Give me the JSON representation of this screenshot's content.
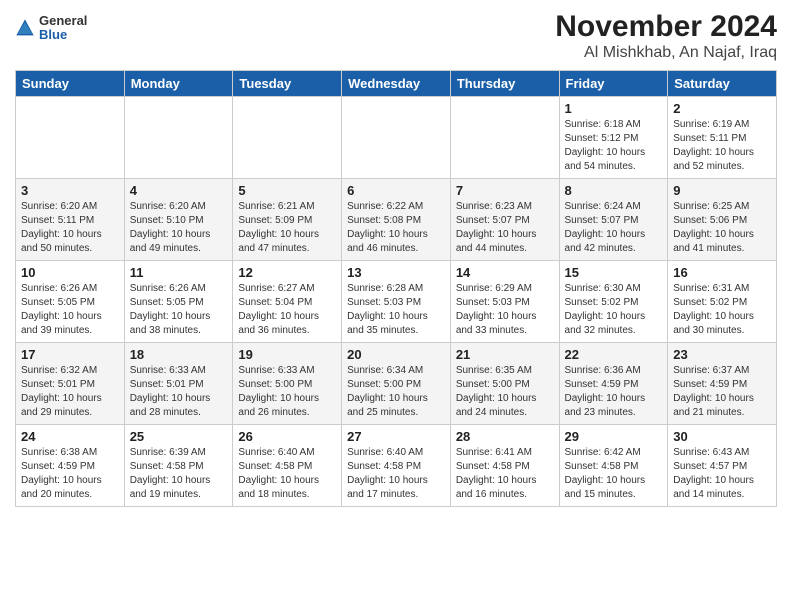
{
  "header": {
    "title": "November 2024",
    "subtitle": "Al Mishkhab, An Najaf, Iraq"
  },
  "logo": {
    "line1": "General",
    "line2": "Blue"
  },
  "days_of_week": [
    "Sunday",
    "Monday",
    "Tuesday",
    "Wednesday",
    "Thursday",
    "Friday",
    "Saturday"
  ],
  "weeks": [
    [
      {
        "day": "",
        "info": ""
      },
      {
        "day": "",
        "info": ""
      },
      {
        "day": "",
        "info": ""
      },
      {
        "day": "",
        "info": ""
      },
      {
        "day": "",
        "info": ""
      },
      {
        "day": "1",
        "info": "Sunrise: 6:18 AM\nSunset: 5:12 PM\nDaylight: 10 hours\nand 54 minutes."
      },
      {
        "day": "2",
        "info": "Sunrise: 6:19 AM\nSunset: 5:11 PM\nDaylight: 10 hours\nand 52 minutes."
      }
    ],
    [
      {
        "day": "3",
        "info": "Sunrise: 6:20 AM\nSunset: 5:11 PM\nDaylight: 10 hours\nand 50 minutes."
      },
      {
        "day": "4",
        "info": "Sunrise: 6:20 AM\nSunset: 5:10 PM\nDaylight: 10 hours\nand 49 minutes."
      },
      {
        "day": "5",
        "info": "Sunrise: 6:21 AM\nSunset: 5:09 PM\nDaylight: 10 hours\nand 47 minutes."
      },
      {
        "day": "6",
        "info": "Sunrise: 6:22 AM\nSunset: 5:08 PM\nDaylight: 10 hours\nand 46 minutes."
      },
      {
        "day": "7",
        "info": "Sunrise: 6:23 AM\nSunset: 5:07 PM\nDaylight: 10 hours\nand 44 minutes."
      },
      {
        "day": "8",
        "info": "Sunrise: 6:24 AM\nSunset: 5:07 PM\nDaylight: 10 hours\nand 42 minutes."
      },
      {
        "day": "9",
        "info": "Sunrise: 6:25 AM\nSunset: 5:06 PM\nDaylight: 10 hours\nand 41 minutes."
      }
    ],
    [
      {
        "day": "10",
        "info": "Sunrise: 6:26 AM\nSunset: 5:05 PM\nDaylight: 10 hours\nand 39 minutes."
      },
      {
        "day": "11",
        "info": "Sunrise: 6:26 AM\nSunset: 5:05 PM\nDaylight: 10 hours\nand 38 minutes."
      },
      {
        "day": "12",
        "info": "Sunrise: 6:27 AM\nSunset: 5:04 PM\nDaylight: 10 hours\nand 36 minutes."
      },
      {
        "day": "13",
        "info": "Sunrise: 6:28 AM\nSunset: 5:03 PM\nDaylight: 10 hours\nand 35 minutes."
      },
      {
        "day": "14",
        "info": "Sunrise: 6:29 AM\nSunset: 5:03 PM\nDaylight: 10 hours\nand 33 minutes."
      },
      {
        "day": "15",
        "info": "Sunrise: 6:30 AM\nSunset: 5:02 PM\nDaylight: 10 hours\nand 32 minutes."
      },
      {
        "day": "16",
        "info": "Sunrise: 6:31 AM\nSunset: 5:02 PM\nDaylight: 10 hours\nand 30 minutes."
      }
    ],
    [
      {
        "day": "17",
        "info": "Sunrise: 6:32 AM\nSunset: 5:01 PM\nDaylight: 10 hours\nand 29 minutes."
      },
      {
        "day": "18",
        "info": "Sunrise: 6:33 AM\nSunset: 5:01 PM\nDaylight: 10 hours\nand 28 minutes."
      },
      {
        "day": "19",
        "info": "Sunrise: 6:33 AM\nSunset: 5:00 PM\nDaylight: 10 hours\nand 26 minutes."
      },
      {
        "day": "20",
        "info": "Sunrise: 6:34 AM\nSunset: 5:00 PM\nDaylight: 10 hours\nand 25 minutes."
      },
      {
        "day": "21",
        "info": "Sunrise: 6:35 AM\nSunset: 5:00 PM\nDaylight: 10 hours\nand 24 minutes."
      },
      {
        "day": "22",
        "info": "Sunrise: 6:36 AM\nSunset: 4:59 PM\nDaylight: 10 hours\nand 23 minutes."
      },
      {
        "day": "23",
        "info": "Sunrise: 6:37 AM\nSunset: 4:59 PM\nDaylight: 10 hours\nand 21 minutes."
      }
    ],
    [
      {
        "day": "24",
        "info": "Sunrise: 6:38 AM\nSunset: 4:59 PM\nDaylight: 10 hours\nand 20 minutes."
      },
      {
        "day": "25",
        "info": "Sunrise: 6:39 AM\nSunset: 4:58 PM\nDaylight: 10 hours\nand 19 minutes."
      },
      {
        "day": "26",
        "info": "Sunrise: 6:40 AM\nSunset: 4:58 PM\nDaylight: 10 hours\nand 18 minutes."
      },
      {
        "day": "27",
        "info": "Sunrise: 6:40 AM\nSunset: 4:58 PM\nDaylight: 10 hours\nand 17 minutes."
      },
      {
        "day": "28",
        "info": "Sunrise: 6:41 AM\nSunset: 4:58 PM\nDaylight: 10 hours\nand 16 minutes."
      },
      {
        "day": "29",
        "info": "Sunrise: 6:42 AM\nSunset: 4:58 PM\nDaylight: 10 hours\nand 15 minutes."
      },
      {
        "day": "30",
        "info": "Sunrise: 6:43 AM\nSunset: 4:57 PM\nDaylight: 10 hours\nand 14 minutes."
      }
    ]
  ]
}
